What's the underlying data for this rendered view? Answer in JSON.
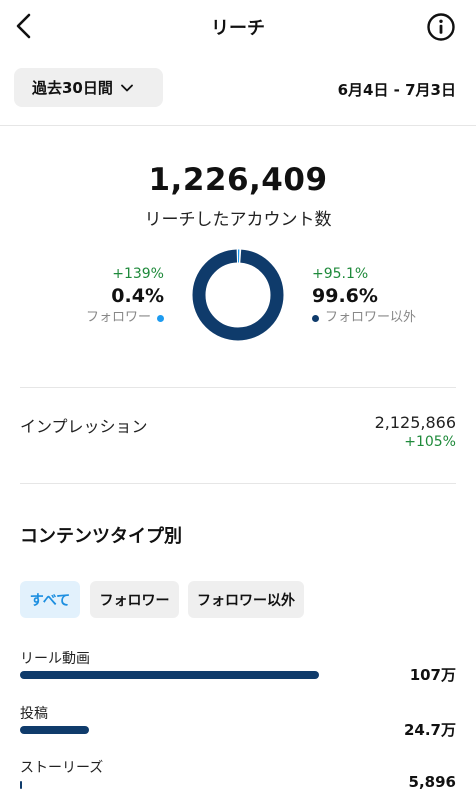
{
  "header": {
    "title": "リーチ",
    "back_icon": "chevron-left-icon",
    "info_icon": "info-circle-icon"
  },
  "filter": {
    "range_label": "過去30日間",
    "date_range": "6月4日 - 7月3日"
  },
  "summary": {
    "accounts_reached": "1,226,409",
    "accounts_reached_label": "リーチしたアカウント数"
  },
  "followers": {
    "change": "+139%",
    "percent": "0.4%",
    "label": "フォロワー",
    "color": "#1d9bf0",
    "share": 0.004
  },
  "non_followers": {
    "change": "+95.1%",
    "percent": "99.6%",
    "label": "フォロワー以外",
    "color": "#0f3b6b",
    "share": 0.996
  },
  "impressions": {
    "label": "インプレッション",
    "value": "2,125,866",
    "change": "+105%"
  },
  "content_type": {
    "title": "コンテンツタイプ別",
    "filters": [
      "すべて",
      "フォロワー",
      "フォロワー以外"
    ],
    "selected_filter": "すべて",
    "accent_color": "#1d8fe0",
    "rows": [
      {
        "label": "リール動画",
        "value": "107万",
        "share": 1.0
      },
      {
        "label": "投稿",
        "value": "24.7万",
        "share": 0.23
      },
      {
        "label": "ストーリーズ",
        "value": "5,896",
        "share": 0.0055
      }
    ]
  }
}
